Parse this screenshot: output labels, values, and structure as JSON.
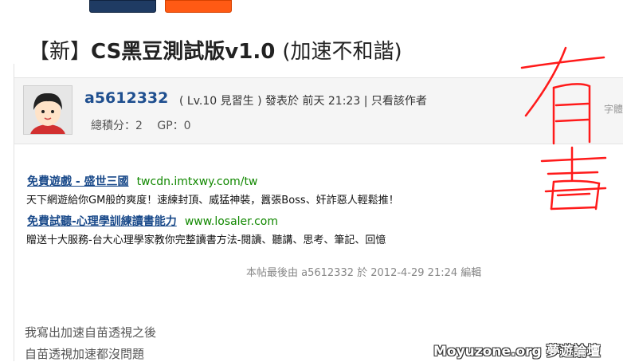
{
  "post": {
    "title_bracket": "【新】",
    "title_main": "CS黑豆測試版v1.0 ",
    "title_suffix": "(加速不和諧)"
  },
  "author": {
    "name": "a5612332",
    "level": "( Lv.10 見習生 )",
    "posted": "發表於 前天 21:23",
    "only_author": "| 只看該作者",
    "total_points": "總積分：2",
    "gp": "GP：0",
    "font_size_label": "字體"
  },
  "ads": [
    {
      "title": "免費遊戲 - 盛世三國",
      "url": "twcdn.imtxwy.com/tw",
      "desc": "天下網遊給你GM般的爽度！速練封頂、威猛神裝，囂張Boss、奸詐惡人輕鬆推！"
    },
    {
      "title": "免費試聽-心理學訓練讀書能力",
      "url": "www.losaler.com",
      "desc": "贈送十大服務-台大心理學家教你完整讀書方法-閱讀、聽講、思考、筆記、回憶"
    }
  ],
  "edit_note": "本帖最後由 a5612332 於 2012-4-29 21:24 編輯",
  "content": {
    "line1": "我寫出加速自苗透視之後",
    "line2": "自苗透視加速都沒問題"
  },
  "watermark": "Moyuzone.org 夢遊論壇",
  "annotation": {
    "handwritten_text": "有毒",
    "color": "#ff1a1a"
  }
}
